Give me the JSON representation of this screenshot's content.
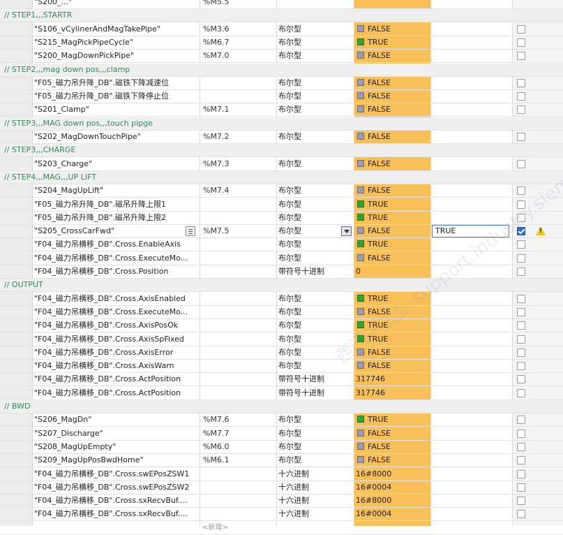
{
  "rows": [
    {
      "type": "var",
      "name": "\"S200_...\"",
      "addr": "%M5.5",
      "fmt": "",
      "val": "",
      "bool": false,
      "partial": true
    },
    {
      "type": "comment",
      "text": "// STEP1,,,STARTR"
    },
    {
      "type": "var",
      "name": "\"S106_vCylinerAndMagTakePipe\"",
      "addr": "%M3.6",
      "fmt": "布尔型",
      "val": "FALSE",
      "bool": true,
      "on": false
    },
    {
      "type": "var",
      "name": "\"S215_MagPickPipeCycle\"",
      "addr": "%M6.7",
      "fmt": "布尔型",
      "val": "TRUE",
      "bool": true,
      "on": true
    },
    {
      "type": "var",
      "name": "\"S200_MagDownPickPipe\"",
      "addr": "%M7.0",
      "fmt": "布尔型",
      "val": "FALSE",
      "bool": true,
      "on": false
    },
    {
      "type": "comment",
      "text": "// STEP2,,,mag down pos,,,clamp"
    },
    {
      "type": "var",
      "name": "\"F05_磁力吊升降_DB\".磁铁下降减速位",
      "addr": "",
      "fmt": "布尔型",
      "val": "FALSE",
      "bool": true,
      "on": false
    },
    {
      "type": "var",
      "name": "\"F05_磁力吊升降_DB\".磁铁下降停止位",
      "addr": "",
      "fmt": "布尔型",
      "val": "FALSE",
      "bool": true,
      "on": false
    },
    {
      "type": "var",
      "name": "\"S201_Clamp\"",
      "addr": "%M7.1",
      "fmt": "布尔型",
      "val": "FALSE",
      "bool": true,
      "on": false
    },
    {
      "type": "comment",
      "text": "// STEP3,,,MAG down pos,,,touch pipge"
    },
    {
      "type": "var",
      "name": "\"S202_MagDownTouchPipe\"",
      "addr": "%M7.2",
      "fmt": "布尔型",
      "val": "FALSE",
      "bool": true,
      "on": false
    },
    {
      "type": "comment",
      "text": "// STEP3,,,CHARGE"
    },
    {
      "type": "var",
      "name": "\"S203_Charge\"",
      "addr": "%M7.3",
      "fmt": "布尔型",
      "val": "FALSE",
      "bool": true,
      "on": false
    },
    {
      "type": "comment",
      "text": "// STEP4,,,MAG,,,UP LIFT"
    },
    {
      "type": "var",
      "name": "\"S204_MagUpLift\"",
      "addr": "%M7.4",
      "fmt": "布尔型",
      "val": "FALSE",
      "bool": true,
      "on": false
    },
    {
      "type": "var",
      "name": "\"F05_磁力吊升降_DB\".磁吊升降上限1",
      "addr": "",
      "fmt": "布尔型",
      "val": "TRUE",
      "bool": true,
      "on": true
    },
    {
      "type": "var",
      "name": "\"F05_磁力吊升降_DB\".磁吊升降上限2",
      "addr": "",
      "fmt": "布尔型",
      "val": "TRUE",
      "bool": true,
      "on": true
    },
    {
      "type": "var",
      "name": "\"S205_CrossCarFwd\"",
      "addr": "%M7.5",
      "fmt": "布尔型",
      "val": "FALSE",
      "bool": true,
      "on": false,
      "active": true,
      "modify": "TRUE",
      "checked": true
    },
    {
      "type": "var",
      "name": "\"F04_磁力吊横移_DB\".Cross.EnableAxis",
      "addr": "",
      "fmt": "布尔型",
      "val": "TRUE",
      "bool": true,
      "on": true
    },
    {
      "type": "var",
      "name": "\"F04_磁力吊横移_DB\".Cross.ExecuteMo...",
      "addr": "",
      "fmt": "布尔型",
      "val": "FALSE",
      "bool": true,
      "on": false
    },
    {
      "type": "var",
      "name": "\"F04_磁力吊横移_DB\".Cross.Position",
      "addr": "",
      "fmt": "带符号十进制",
      "val": "0",
      "bool": false
    },
    {
      "type": "comment",
      "text": "// OUTPUT"
    },
    {
      "type": "var",
      "name": "\"F04_磁力吊横移_DB\".Cross.AxisEnabled",
      "addr": "",
      "fmt": "布尔型",
      "val": "TRUE",
      "bool": true,
      "on": true
    },
    {
      "type": "var",
      "name": "\"F04_磁力吊横移_DB\".Cross.ExecuteMo...",
      "addr": "",
      "fmt": "布尔型",
      "val": "FALSE",
      "bool": true,
      "on": false
    },
    {
      "type": "var",
      "name": "\"F04_磁力吊横移_DB\".Cross.AxisPosOk",
      "addr": "",
      "fmt": "布尔型",
      "val": "TRUE",
      "bool": true,
      "on": true
    },
    {
      "type": "var",
      "name": "\"F04_磁力吊横移_DB\".Cross.AxisSpFixed",
      "addr": "",
      "fmt": "布尔型",
      "val": "TRUE",
      "bool": true,
      "on": true
    },
    {
      "type": "var",
      "name": "\"F04_磁力吊横移_DB\".Cross.AxisError",
      "addr": "",
      "fmt": "布尔型",
      "val": "FALSE",
      "bool": true,
      "on": false
    },
    {
      "type": "var",
      "name": "\"F04_磁力吊横移_DB\".Cross.AxisWarn",
      "addr": "",
      "fmt": "布尔型",
      "val": "FALSE",
      "bool": true,
      "on": false
    },
    {
      "type": "var",
      "name": "\"F04_磁力吊横移_DB\".Cross.ActPosition",
      "addr": "",
      "fmt": "带符号十进制",
      "val": "317746",
      "bool": false
    },
    {
      "type": "var",
      "name": "\"F04_磁力吊横移_DB\".Cross.ActPosition",
      "addr": "",
      "fmt": "带符号十进制",
      "val": "317746",
      "bool": false
    },
    {
      "type": "comment",
      "text": "// BWD"
    },
    {
      "type": "var",
      "name": "\"S206_MagDn\"",
      "addr": "%M7.6",
      "fmt": "布尔型",
      "val": "TRUE",
      "bool": true,
      "on": true
    },
    {
      "type": "var",
      "name": "\"S207_Discharge\"",
      "addr": "%M7.7",
      "fmt": "布尔型",
      "val": "FALSE",
      "bool": true,
      "on": false
    },
    {
      "type": "var",
      "name": "\"S208_MagUpEmpty\"",
      "addr": "%M6.0",
      "fmt": "布尔型",
      "val": "FALSE",
      "bool": true,
      "on": false
    },
    {
      "type": "var",
      "name": "\"S209_MagUpPosBwdHome\"",
      "addr": "%M6.1",
      "fmt": "布尔型",
      "val": "FALSE",
      "bool": true,
      "on": false
    },
    {
      "type": "var",
      "name": "\"F04_磁力吊横移_DB\".Cross.swEPosZSW1",
      "addr": "",
      "fmt": "十六进制",
      "val": "16#8000",
      "bool": false
    },
    {
      "type": "var",
      "name": "\"F04_磁力吊横移_DB\".Cross.swEPosZSW2",
      "addr": "",
      "fmt": "十六进制",
      "val": "16#0004",
      "bool": false
    },
    {
      "type": "var",
      "name": "\"F04_磁力吊横移_DB\".Cross.sxRecvBuf....",
      "addr": "",
      "fmt": "十六进制",
      "val": "16#8000",
      "bool": false
    },
    {
      "type": "var",
      "name": "\"F04_磁力吊横移_DB\".Cross.sxRecvBuf....",
      "addr": "",
      "fmt": "十六进制",
      "val": "16#0004",
      "bool": false
    },
    {
      "type": "new",
      "name": "<新增>"
    }
  ],
  "watermark": "西门子工业 support.industry.siemens.cn",
  "colors": {
    "value_column": "#f9bf58",
    "comment_green": "#2e8b57",
    "true_green": "#2fa62f"
  },
  "icons": {
    "bool_true": "green-square-icon",
    "bool_false": "grey-square-icon",
    "warning": "warning-triangle-icon",
    "browse": "list-browse-icon",
    "dropdown": "dropdown-arrow-icon"
  }
}
